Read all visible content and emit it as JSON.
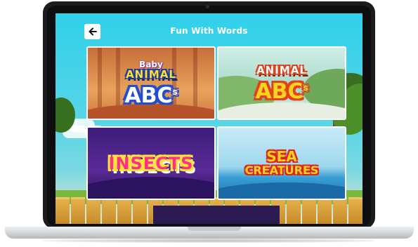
{
  "app": {
    "title": "Fun With Words",
    "back_icon": "arrow-left-icon"
  },
  "categories": [
    {
      "small_label": "Baby",
      "line1": "ANIMAL",
      "line2": "ABC",
      "superscript": "s"
    },
    {
      "line1": "ANIMAL",
      "line2": "ABC",
      "superscript": "s"
    },
    {
      "line1": "INSECTS"
    },
    {
      "line1": "SEA",
      "line2": "CREATURES"
    }
  ],
  "colors": {
    "sky": "#3ed0e6",
    "title_text": "#ffffff",
    "fence": "#d79a38",
    "bottom_bar": "#2e1a52"
  }
}
